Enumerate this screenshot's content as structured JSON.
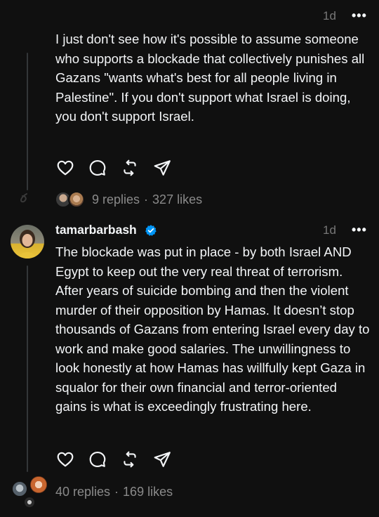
{
  "post1": {
    "time": "1d",
    "more": "•••",
    "text": "I just don't see how it's possible to assume someone who supports a blockade that collectively punishes all Gazans \"wants what's best for all people living in Palestine\". If you don't support what Israel is doing, you don't support Israel.",
    "replies": "9 replies",
    "separator": "·",
    "likes": "327 likes"
  },
  "post2": {
    "username": "tamarbarbash",
    "verified": true,
    "time": "1d",
    "more": "•••",
    "text": "The blockade was put in place - by both Israel AND Egypt to keep out the very real threat of terrorism. After years of suicide bombing and then the violent murder of their opposition by Hamas. It doesn’t stop thousands of Gazans from entering Israel every day to work and make good salaries. The unwillingness to look honestly at how Hamas has willfully kept Gaza in squalor for their own financial and terror-oriented gains is what is exceedingly frustrating here.",
    "replies": "40 replies",
    "separator": "·",
    "likes": "169 likes"
  },
  "icons": [
    "heart-icon",
    "comment-icon",
    "repost-icon",
    "share-icon",
    "verified-badge-icon"
  ],
  "colors": {
    "background": "#101010",
    "text": "#f3f5f7",
    "muted": "#8a8a8a",
    "verified": "#0095f6"
  }
}
